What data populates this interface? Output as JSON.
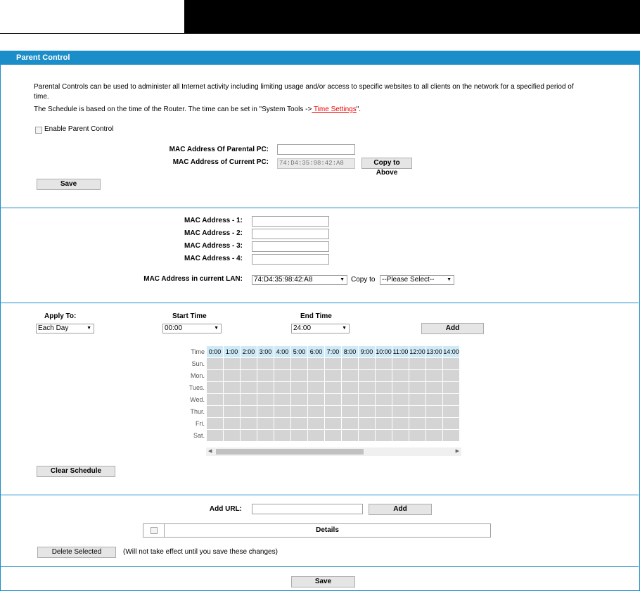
{
  "panel": {
    "title": "Parent Control"
  },
  "intro": {
    "line1": "Parental Controls can be used to administer all Internet activity including limiting usage and/or access to specific websites to all clients on the network for a specified period of",
    "line1b": "time.",
    "line2_prefix": "The Schedule is based on the time of the Router. The time can be set in \"System Tools ->",
    "line2_link": " Time Settings",
    "line2_suffix": "\"."
  },
  "enable": {
    "label": "Enable Parent Control",
    "checked": false
  },
  "parental_pc": {
    "label": "MAC Address Of Parental PC:",
    "value": "",
    "current_label": "MAC Address of Current PC:",
    "current_value": "74:D4:35:98:42:A8",
    "copy_label": "Copy to Above"
  },
  "save1": "Save",
  "children": {
    "rows": [
      {
        "label": "MAC Address - 1:",
        "value": ""
      },
      {
        "label": "MAC Address - 2:",
        "value": ""
      },
      {
        "label": "MAC Address - 3:",
        "value": ""
      },
      {
        "label": "MAC Address - 4:",
        "value": ""
      }
    ],
    "lan_label": "MAC Address in current LAN:",
    "lan_value": "74:D4:35:98:42:A8",
    "copy_to_label": "Copy to",
    "copy_to_value": "--Please Select--"
  },
  "schedule": {
    "apply_label": "Apply To:",
    "apply_value": "Each Day",
    "start_label": "Start Time",
    "start_value": "00:00",
    "end_label": "End Time",
    "end_value": "24:00",
    "add_label": "Add",
    "time_header": "Time",
    "hours": [
      "0:00",
      "1:00",
      "2:00",
      "3:00",
      "4:00",
      "5:00",
      "6:00",
      "7:00",
      "8:00",
      "9:00",
      "10:00",
      "11:00",
      "12:00",
      "13:00",
      "14:00"
    ],
    "days": [
      "Sun.",
      "Mon.",
      "Tues.",
      "Wed.",
      "Thur.",
      "Fri.",
      "Sat."
    ],
    "clear_label": "Clear Schedule"
  },
  "url": {
    "label": "Add URL:",
    "value": "",
    "add_label": "Add",
    "details_header": "Details",
    "delete_label": "Delete Selected",
    "delete_note": "(Will not take effect until you save these changes)"
  },
  "save2": "Save",
  "colors": {
    "accent": "#1b8dc8",
    "link": "#e00000",
    "grid_cell": "#d4d4d4",
    "grid_header": "#cfeaf6"
  },
  "icons": {
    "dropdown": "dropdown-arrow-icon",
    "scroll_left": "scroll-left-arrow-icon",
    "scroll_right": "scroll-right-arrow-icon"
  }
}
